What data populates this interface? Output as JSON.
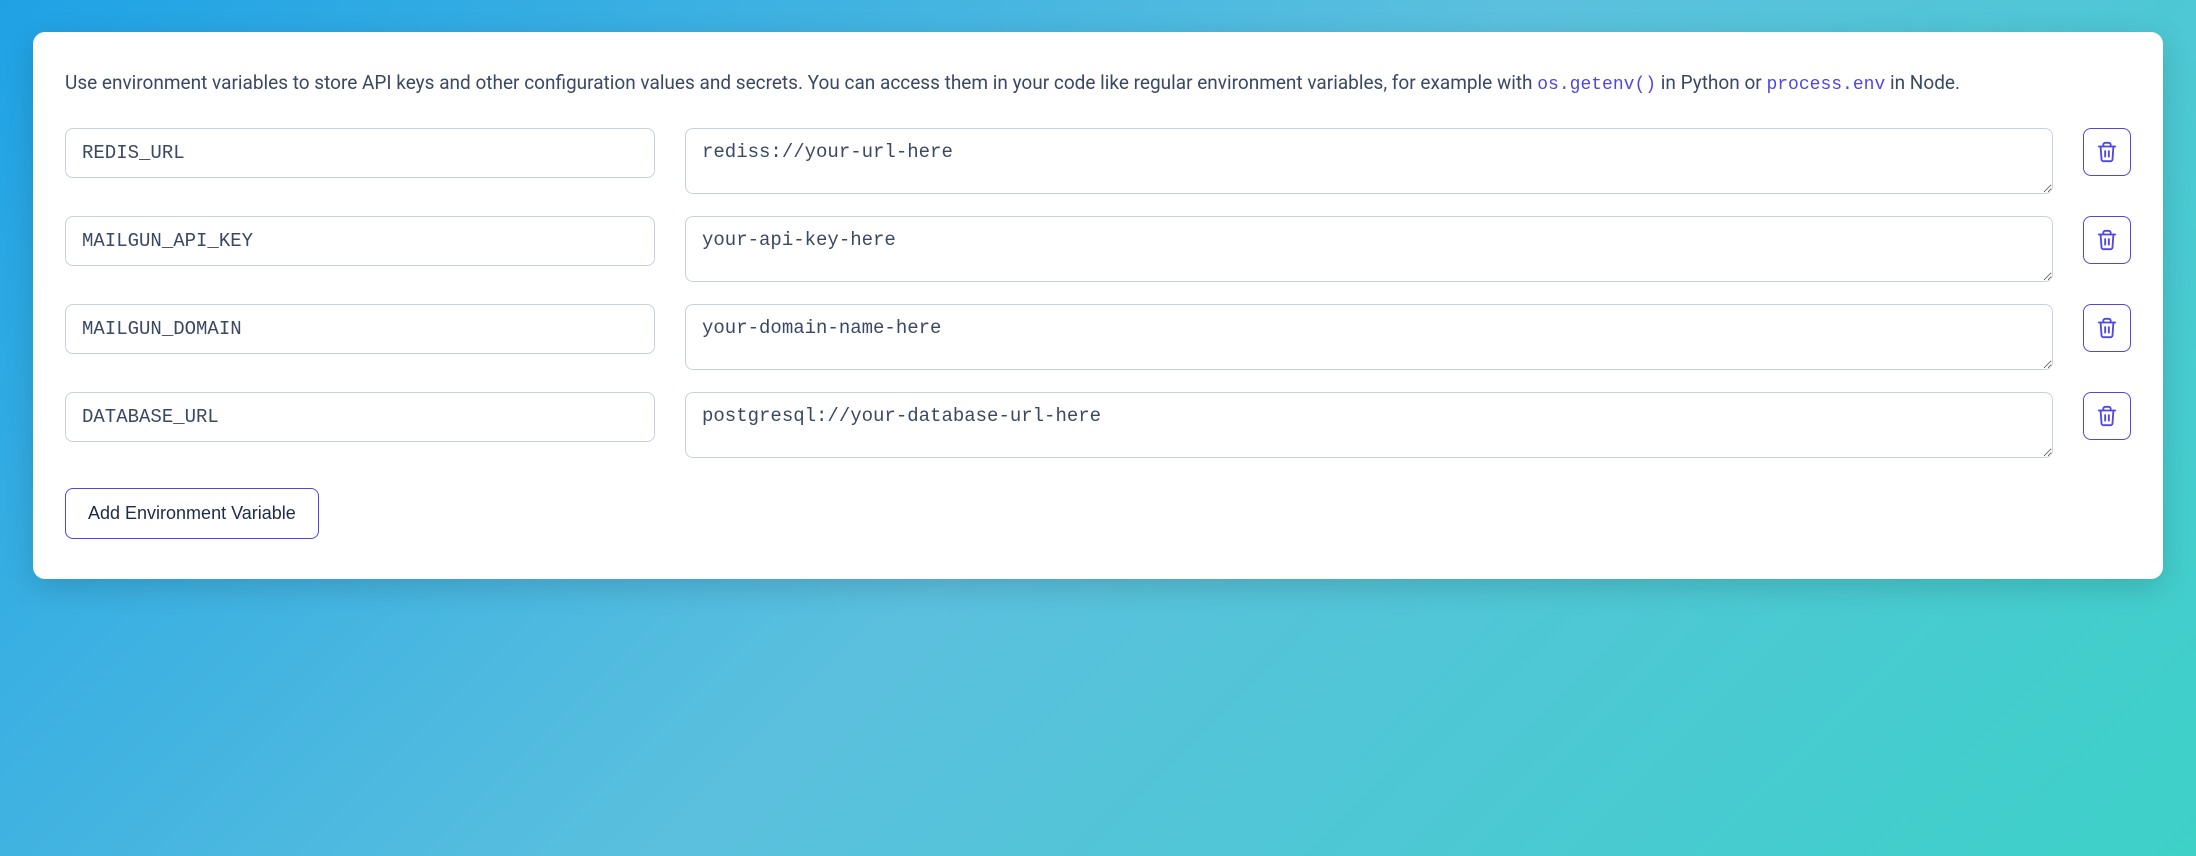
{
  "intro": {
    "text_before_code1": "Use environment variables to store API keys and other configuration values and secrets. You can access them in your code like regular environment variables, for example with ",
    "code1": "os.getenv()",
    "text_mid": " in Python or ",
    "code2": "process.env",
    "text_after_code2": " in Node."
  },
  "env_vars": [
    {
      "key": "REDIS_URL",
      "value": "rediss://your-url-here"
    },
    {
      "key": "MAILGUN_API_KEY",
      "value": "your-api-key-here"
    },
    {
      "key": "MAILGUN_DOMAIN",
      "value": "your-domain-name-here"
    },
    {
      "key": "DATABASE_URL",
      "value": "postgresql://your-database-url-here"
    }
  ],
  "buttons": {
    "add_label": "Add Environment Variable"
  }
}
